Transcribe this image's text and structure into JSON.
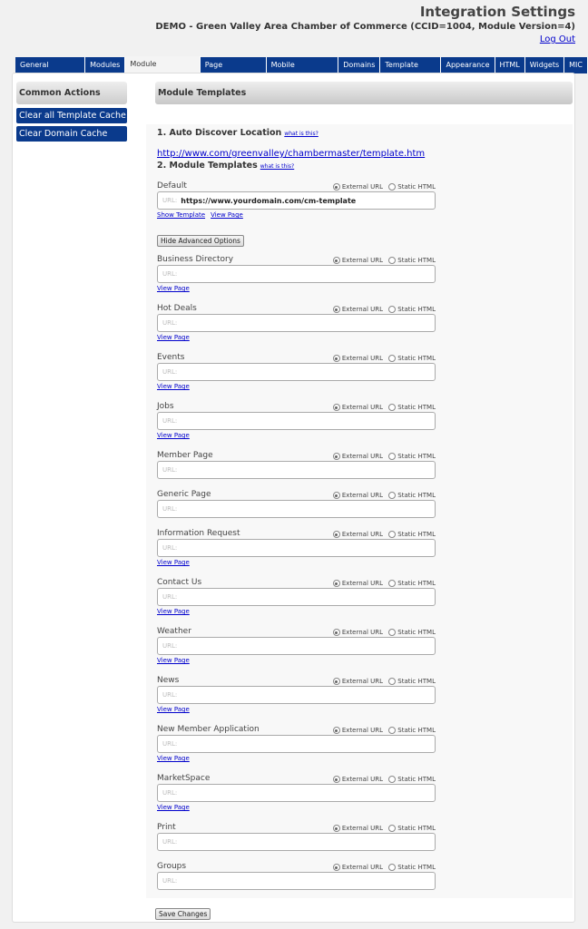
{
  "header": {
    "title": "Integration Settings",
    "subtitle": "DEMO - Green Valley Area Chamber of Commerce (CCID=1004, Module Version=4)",
    "logout": "Log Out"
  },
  "tabs": [
    "General Settings",
    "Modules",
    "Module Templates",
    "Page Templates",
    "Mobile Templates",
    "Domains",
    "Template Tags",
    "Appearance",
    "HTML",
    "Widgets",
    "MIC"
  ],
  "active_tab": "Module Templates",
  "sidebar": {
    "title": "Common Actions",
    "actions": [
      "Clear all Template Cache",
      "Clear Domain Cache"
    ]
  },
  "main": {
    "title": "Module Templates",
    "section1": "1. Auto Discover Location",
    "what_is_this": "what is this?",
    "auto_discover_url": "http://www.com/greenvalley/chambermaster/template.htm",
    "section2": "2. Module Templates",
    "external_url": "External URL",
    "static_html": "Static HTML",
    "url_prefix": "URL:",
    "show_template": "Show Template",
    "view_page": "View Page",
    "hide_advanced": "Hide Advanced Options",
    "default": {
      "label": "Default",
      "value": "https://www.yourdomain.com/cm-template",
      "mode": "External URL"
    },
    "fields": [
      {
        "label": "Business Directory",
        "value": "",
        "view": true
      },
      {
        "label": "Hot Deals",
        "value": "",
        "view": true
      },
      {
        "label": "Events",
        "value": "",
        "view": true
      },
      {
        "label": "Jobs",
        "value": "",
        "view": true
      },
      {
        "label": "Member Page",
        "value": "",
        "view": false
      },
      {
        "label": "Generic Page",
        "value": "",
        "view": false
      },
      {
        "label": "Information Request",
        "value": "",
        "view": true
      },
      {
        "label": "Contact Us",
        "value": "",
        "view": true
      },
      {
        "label": "Weather",
        "value": "",
        "view": true
      },
      {
        "label": "News",
        "value": "",
        "view": true
      },
      {
        "label": "New Member Application",
        "value": "",
        "view": true
      },
      {
        "label": "MarketSpace",
        "value": "",
        "view": true
      },
      {
        "label": "Print",
        "value": "",
        "view": false
      },
      {
        "label": "Groups",
        "value": "",
        "view": false
      }
    ],
    "save": "Save Changes"
  },
  "colors": {
    "tab_bg": "#0a3a8c",
    "link": "#0000cc"
  }
}
